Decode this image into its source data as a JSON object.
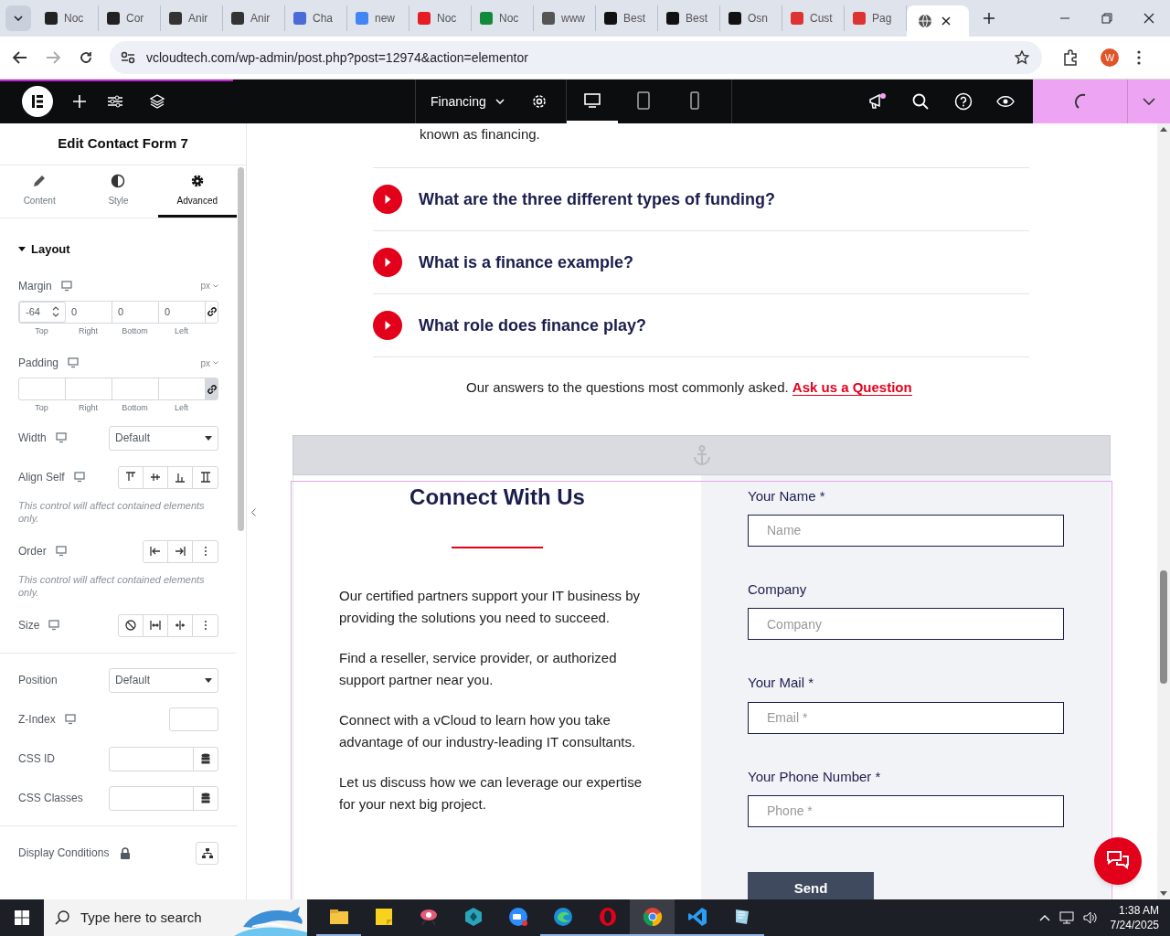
{
  "browser": {
    "tabs": [
      {
        "title": "Noc",
        "selected": false
      },
      {
        "title": "Cor",
        "selected": false
      },
      {
        "title": "Anir",
        "selected": false
      },
      {
        "title": "Anir",
        "selected": false
      },
      {
        "title": "Cha",
        "selected": false
      },
      {
        "title": "new",
        "selected": false
      },
      {
        "title": "Noc",
        "selected": false
      },
      {
        "title": "Noc",
        "selected": false
      },
      {
        "title": "www",
        "selected": false
      },
      {
        "title": "Best",
        "selected": false
      },
      {
        "title": "Best",
        "selected": false
      },
      {
        "title": "Osn",
        "selected": false
      },
      {
        "title": "Cust",
        "selected": false
      },
      {
        "title": "Pag",
        "selected": false
      },
      {
        "selected": true
      }
    ],
    "url": "vcloudtech.com/wp-admin/post.php?post=12974&action=elementor",
    "profile_initial": "W"
  },
  "editor_bar": {
    "page_title": "Financing",
    "devices": [
      {
        "kind": "desktop",
        "selected": true
      },
      {
        "kind": "tablet",
        "selected": false
      },
      {
        "kind": "mobile",
        "selected": false
      }
    ]
  },
  "panel": {
    "title": "Edit Contact Form 7",
    "tabs": [
      {
        "label": "Content",
        "selected": false
      },
      {
        "label": "Style",
        "selected": false
      },
      {
        "label": "Advanced",
        "selected": true
      }
    ],
    "section": "Layout",
    "margin": {
      "label": "Margin",
      "unit": "px",
      "values": [
        "-64",
        "0",
        "0",
        "0"
      ],
      "sides": [
        "Top",
        "Right",
        "Bottom",
        "Left"
      ]
    },
    "padding": {
      "label": "Padding",
      "unit": "px",
      "sides": [
        "Top",
        "Right",
        "Bottom",
        "Left"
      ]
    },
    "rows": [
      {
        "kind": "select",
        "label": "Width",
        "value": "Default",
        "responsive": true
      },
      {
        "kind": "align",
        "label": "Align Self",
        "responsive": true,
        "note": "This control will affect contained elements only."
      },
      {
        "kind": "order",
        "label": "Order",
        "responsive": true,
        "note": "This control will affect contained elements only."
      },
      {
        "kind": "size",
        "label": "Size",
        "responsive": true
      },
      {
        "kind": "select",
        "label": "Position",
        "value": "Default",
        "responsive": false
      },
      {
        "kind": "number",
        "label": "Z-Index",
        "responsive": true
      },
      {
        "kind": "text",
        "label": "CSS ID",
        "responsive": false
      },
      {
        "kind": "text",
        "label": "CSS Classes",
        "responsive": false
      },
      {
        "kind": "conditions",
        "label": "Display Conditions",
        "responsive": false
      }
    ]
  },
  "canvas": {
    "intro_tail": "known as financing.",
    "faqs": [
      "What are the three different types of funding?",
      "What is a finance example?",
      "What role does finance play?"
    ],
    "answers_text": "Our answers to the questions most commonly asked.",
    "answers_link": "Ask us a Question",
    "heading": "Connect With Us",
    "paragraphs": [
      "Our certified partners support your IT business by providing the solutions you need to succeed.",
      "Find a reseller, service provider, or authorized support partner near you.",
      "Connect with a vCloud to learn how you take advantage of our industry-leading IT consultants.",
      "Let us discuss how we can leverage our expertise for your next big project."
    ],
    "form": {
      "fields": [
        {
          "label": "Your Name *",
          "placeholder": "Name"
        },
        {
          "label": "Company",
          "placeholder": "Company"
        },
        {
          "label": "Your Mail *",
          "placeholder": "Email *"
        },
        {
          "label": "Your Phone Number *",
          "placeholder": "Phone *"
        }
      ],
      "button": "Send"
    }
  },
  "taskbar": {
    "search_placeholder": "Type here to search",
    "time": "1:38 AM",
    "date": "7/24/2025"
  }
}
